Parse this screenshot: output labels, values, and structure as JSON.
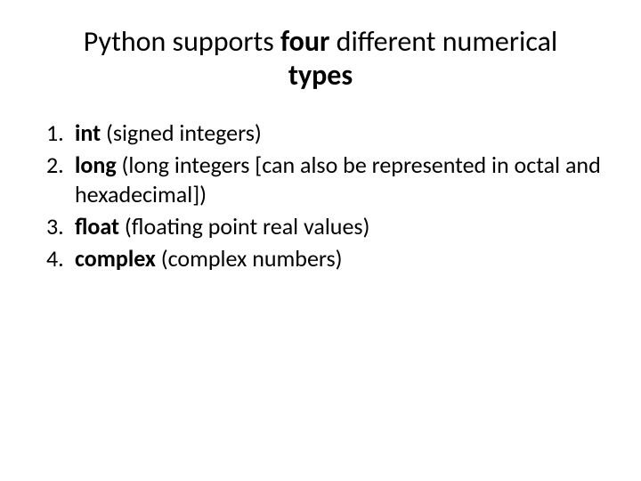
{
  "title": {
    "part1": "Python supports ",
    "bold1": "four",
    "part2": " different numerical ",
    "bold2": "types"
  },
  "list": [
    {
      "number": "1.",
      "bold": "int",
      "rest": " (signed integers)"
    },
    {
      "number": "2.",
      "bold": "long",
      "rest": " (long integers [can also be represented in octal and hexadecimal])"
    },
    {
      "number": "3.",
      "bold": "float",
      "rest": " (floating point real values)"
    },
    {
      "number": "4.",
      "bold": "complex",
      "rest": " (complex numbers)"
    }
  ]
}
